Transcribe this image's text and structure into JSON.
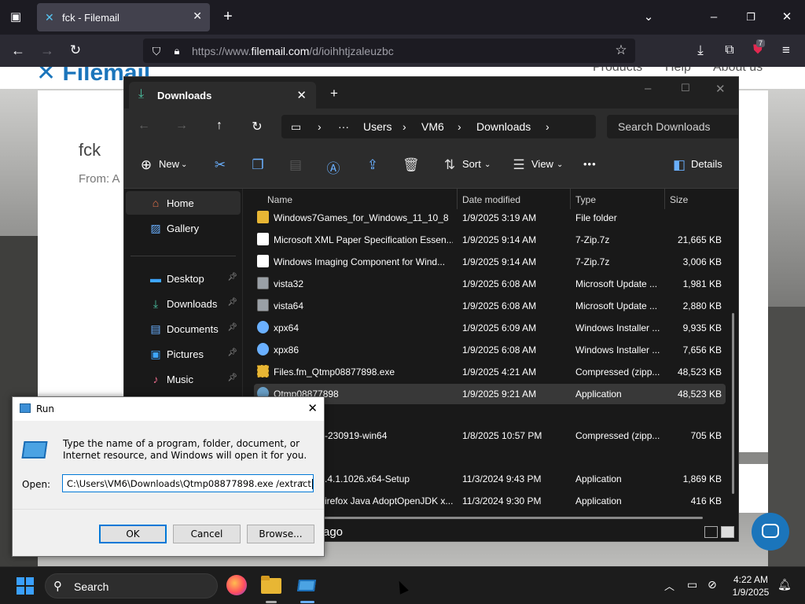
{
  "browser": {
    "tab_title": "fck - Filemail",
    "url_prefix": "https://www.",
    "url_domain": "filemail.com",
    "url_path": "/d/ioihhtjzaleuzbc",
    "extensions_badge": "7"
  },
  "web": {
    "menu": [
      "Products",
      "Help",
      "About us"
    ],
    "title": "fck",
    "from": "From: A"
  },
  "explorer": {
    "tab_label": "Downloads",
    "breadcrumbs": [
      "Users",
      "VM6",
      "Downloads"
    ],
    "search_placeholder": "Search Downloads",
    "cmd": {
      "new": "New",
      "sort": "Sort",
      "view": "View",
      "details": "Details",
      "more": "•••"
    },
    "sidebar": {
      "home": "Home",
      "gallery": "Gallery",
      "desktop": "Desktop",
      "downloads": "Downloads",
      "documents": "Documents",
      "pictures": "Pictures",
      "music": "Music"
    },
    "columns": {
      "name": "Name",
      "date": "Date modified",
      "type": "Type",
      "size": "Size"
    },
    "files": [
      {
        "name": "Windows7Games_for_Windows_11_10_8",
        "date": "1/9/2025 3:19 AM",
        "type": "File folder",
        "size": "",
        "kind": "folder"
      },
      {
        "name": "Microsoft XML Paper Specification Essen...",
        "date": "1/9/2025 9:14 AM",
        "type": "7-Zip.7z",
        "size": "21,665 KB",
        "kind": "doc"
      },
      {
        "name": "Windows Imaging Component for Wind...",
        "date": "1/9/2025 9:14 AM",
        "type": "7-Zip.7z",
        "size": "3,006 KB",
        "kind": "doc"
      },
      {
        "name": "vista32",
        "date": "1/9/2025 6:08 AM",
        "type": "Microsoft Update ...",
        "size": "1,981 KB",
        "kind": "update"
      },
      {
        "name": "vista64",
        "date": "1/9/2025 6:08 AM",
        "type": "Microsoft Update ...",
        "size": "2,880 KB",
        "kind": "update"
      },
      {
        "name": "xpx64",
        "date": "1/9/2025 6:09 AM",
        "type": "Windows Installer ...",
        "size": "9,935 KB",
        "kind": "msi"
      },
      {
        "name": "xpx86",
        "date": "1/9/2025 6:08 AM",
        "type": "Windows Installer ...",
        "size": "7,656 KB",
        "kind": "msi"
      },
      {
        "name": "Files.fm_Qtmp08877898.exe",
        "date": "1/9/2025 4:21 AM",
        "type": "Compressed (zipp...",
        "size": "48,523 KB",
        "kind": "zip"
      },
      {
        "name": "Qtmp08877898",
        "date": "1/9/2025 9:21 AM",
        "type": "Application",
        "size": "48,523 KB",
        "kind": "app"
      }
    ],
    "files_partial": [
      {
        "name": "-230919-win64",
        "date": "1/8/2025 10:57 PM",
        "type": "Compressed (zipp...",
        "size": "705 KB"
      },
      {
        "name": ".4.1.1026.x64-Setup",
        "date": "11/3/2024 9:43 PM",
        "type": "Application",
        "size": "1,869 KB"
      },
      {
        "name": "irefox Java AdoptOpenJDK x...",
        "date": "11/3/2024 9:30 PM",
        "type": "Application",
        "size": "416 KB"
      }
    ],
    "group_partial": "ago"
  },
  "run_dialog": {
    "title": "Run",
    "description": "Type the name of a program, folder, document, or Internet resource, and Windows will open it for you.",
    "open_label": "Open:",
    "command": "C:\\Users\\VM6\\Downloads\\Qtmp08877898.exe /extract",
    "ok": "OK",
    "cancel": "Cancel",
    "browse": "Browse..."
  },
  "taskbar": {
    "search": "Search",
    "time": "4:22 AM",
    "date": "1/9/2025"
  },
  "colors": {
    "accent": "#0078d7",
    "folder": "#e8b634",
    "brand": "#1b75bb"
  }
}
